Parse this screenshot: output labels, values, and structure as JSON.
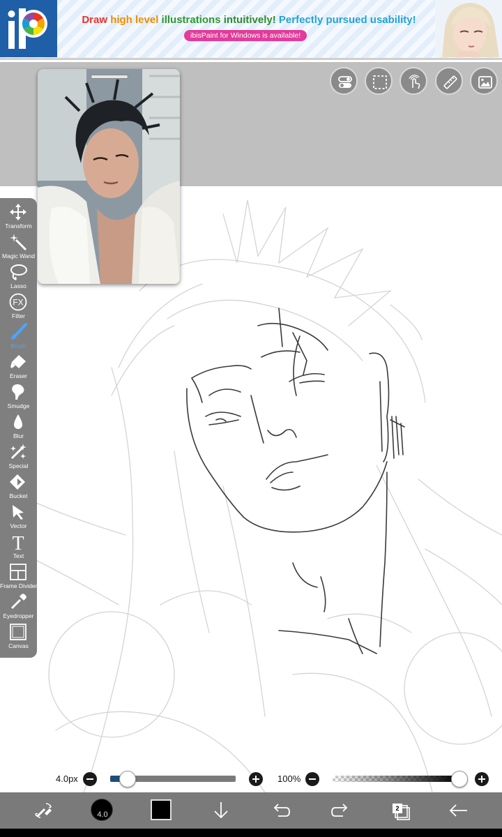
{
  "ad": {
    "headline_draw": "Draw ",
    "headline_high_level": "high level ",
    "headline_illustrations": "illustrations ",
    "headline_intuitively": "intuitively! ",
    "headline_usability": "Perfectly pursued usability!",
    "subtitle": "ibisPaint for Windows is available!",
    "logo_icon": "ibispaint-logo-icon"
  },
  "top_tools": [
    {
      "name": "toggle-icon"
    },
    {
      "name": "selection-icon"
    },
    {
      "name": "touch-icon"
    },
    {
      "name": "ruler-icon"
    },
    {
      "name": "image-icon"
    }
  ],
  "toolbar": {
    "items": [
      {
        "label": "Transform",
        "icon": "transform-icon"
      },
      {
        "label": "Magic Wand",
        "icon": "magic-wand-icon"
      },
      {
        "label": "Lasso",
        "icon": "lasso-icon"
      },
      {
        "label": "Filter",
        "icon": "filter-icon"
      },
      {
        "label": "Brush",
        "icon": "brush-icon",
        "active": true
      },
      {
        "label": "Eraser",
        "icon": "eraser-icon"
      },
      {
        "label": "Smudge",
        "icon": "smudge-icon"
      },
      {
        "label": "Blur",
        "icon": "blur-icon"
      },
      {
        "label": "Special",
        "icon": "special-icon"
      },
      {
        "label": "Bucket",
        "icon": "bucket-icon"
      },
      {
        "label": "Vector",
        "icon": "vector-icon"
      },
      {
        "label": "Text",
        "icon": "text-icon"
      },
      {
        "label": "Frame Divider",
        "icon": "frame-divider-icon"
      },
      {
        "label": "Eyedropper",
        "icon": "eyedropper-icon"
      },
      {
        "label": "Canvas",
        "icon": "canvas-icon"
      }
    ],
    "filter_glyph": "FX",
    "text_glyph": "T"
  },
  "brush": {
    "size_label": "4.0px",
    "size_fraction": 0.14,
    "opacity_label": "100%",
    "opacity_fraction": 1.0,
    "preview_value": "4.0"
  },
  "bottom_bar": {
    "color": "#000000",
    "layer_count": "2",
    "icons": [
      "brush-swap-icon",
      "brush-size-icon",
      "color-icon",
      "download-icon",
      "undo-icon",
      "redo-icon",
      "layers-icon",
      "back-icon"
    ]
  },
  "colors": {
    "toolbar_bg": "#7f7f7f",
    "active_tool": "#4aa6ff",
    "workspace": "#bfbfbf"
  }
}
